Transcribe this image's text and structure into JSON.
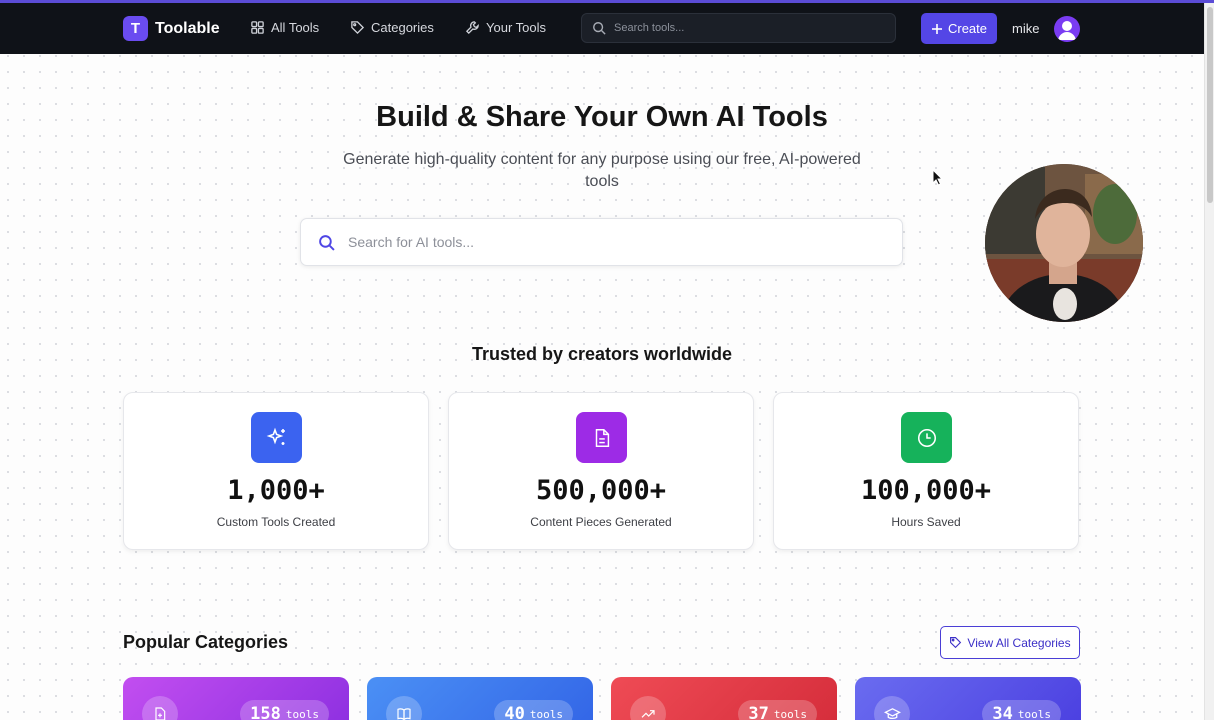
{
  "navbar": {
    "logo_letter": "T",
    "brand": "Toolable",
    "nav_items": [
      "All Tools",
      "Categories",
      "Your Tools"
    ],
    "search_placeholder": "Search tools...",
    "create_label": "Create",
    "username": "mike"
  },
  "hero": {
    "title": "Build & Share Your Own AI Tools",
    "subtitle": "Generate high-quality content for any purpose using our free, AI-powered tools",
    "search_placeholder": "Search for AI tools..."
  },
  "stats": {
    "heading": "Trusted by creators worldwide",
    "items": [
      {
        "value": "1,000+",
        "label": "Custom Tools Created",
        "icon": "sparkles-icon",
        "color": "#3b63f0"
      },
      {
        "value": "500,000+",
        "label": "Content Pieces Generated",
        "icon": "document-icon",
        "color": "#9d2be6"
      },
      {
        "value": "100,000+",
        "label": "Hours Saved",
        "icon": "clock-icon",
        "color": "#16b25b"
      }
    ]
  },
  "categories": {
    "heading": "Popular Categories",
    "view_all_label": "View All Categories",
    "items": [
      {
        "count": "158",
        "unit": "tools",
        "icon": "file-plus-icon",
        "color": "#a437e8"
      },
      {
        "count": "40",
        "unit": "tools",
        "icon": "book-icon",
        "color": "#3d78ef"
      },
      {
        "count": "37",
        "unit": "tools",
        "icon": "trending-up-icon",
        "color": "#e03a44"
      },
      {
        "count": "34",
        "unit": "tools",
        "icon": "graduation-cap-icon",
        "color": "#5a55e6"
      }
    ]
  }
}
